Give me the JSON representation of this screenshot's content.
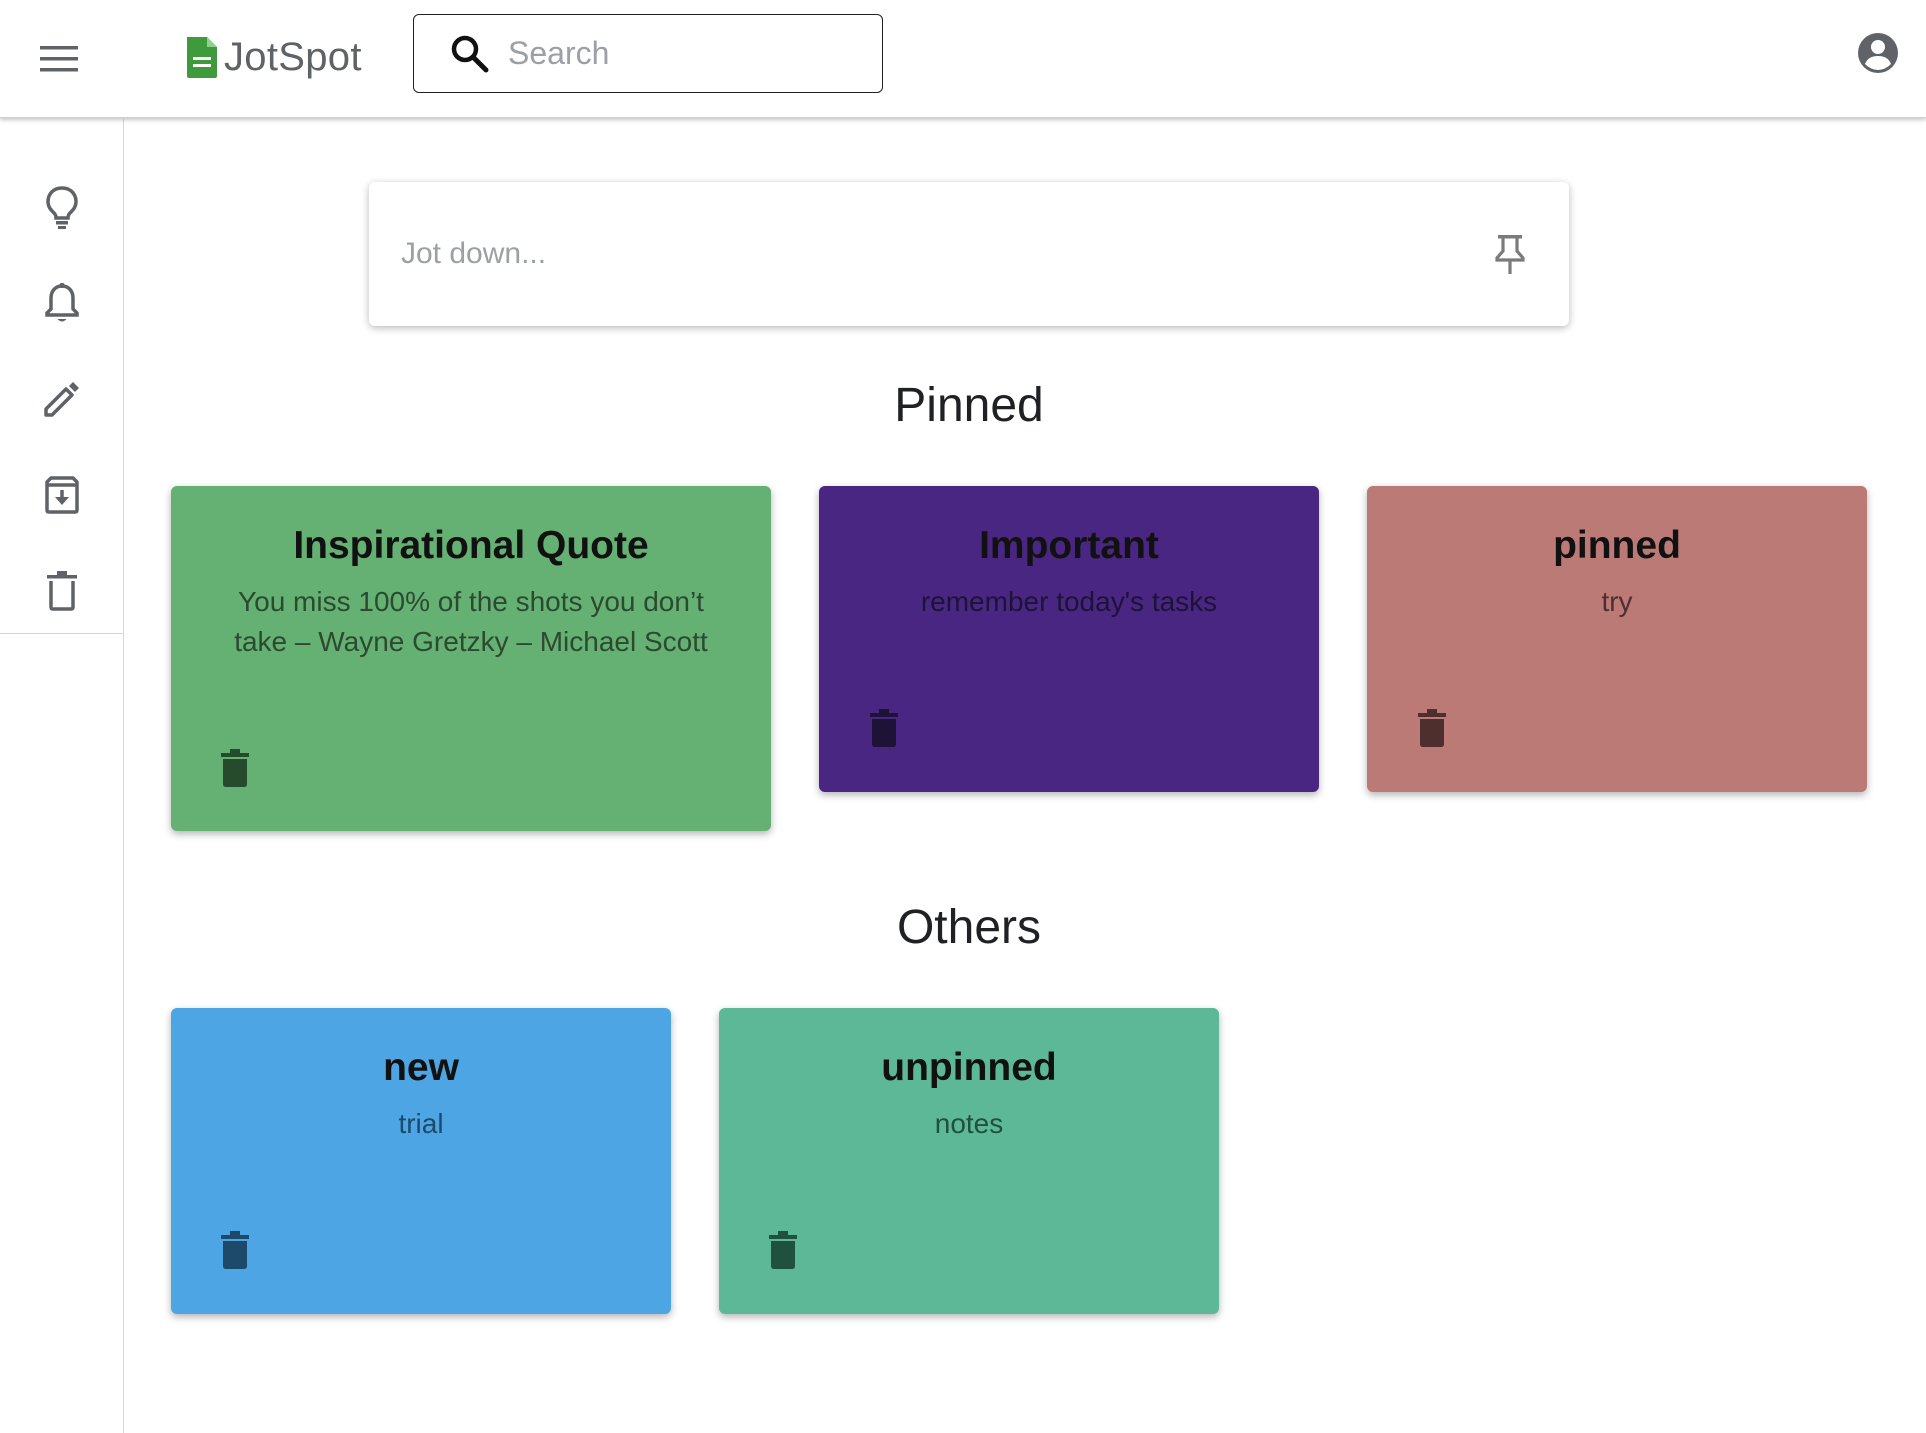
{
  "app": {
    "name": "JotSpot",
    "brand_color": "#4caf50"
  },
  "header": {
    "menu_icon": "hamburger-menu-icon",
    "search": {
      "placeholder": "Search",
      "value": ""
    },
    "account_icon": "account-circle-icon"
  },
  "sidebar": {
    "items": [
      {
        "name": "notes",
        "icon": "lightbulb-icon"
      },
      {
        "name": "reminders",
        "icon": "bell-icon"
      },
      {
        "name": "edit-labels",
        "icon": "pencil-icon"
      },
      {
        "name": "archive",
        "icon": "archive-icon"
      },
      {
        "name": "trash",
        "icon": "trash-icon"
      }
    ]
  },
  "composer": {
    "placeholder": "Jot down...",
    "pin_icon": "pin-icon"
  },
  "sections": {
    "pinned_title": "Pinned",
    "others_title": "Others"
  },
  "pinned_notes": [
    {
      "title": "Inspirational Quote",
      "body": "You miss 100% of the shots you don’t take – Wayne Gretzky – Michael Scott",
      "color": "#65b073",
      "trash_color": "#254a2c"
    },
    {
      "title": "Important",
      "body": "remember today's tasks",
      "color": "#4a2683",
      "trash_color": "#1e1236"
    },
    {
      "title": "pinned",
      "body": "try",
      "color": "#bc7a77",
      "trash_color": "#4e2f2e"
    }
  ],
  "other_notes": [
    {
      "title": "new",
      "body": "trial",
      "color": "#4da6e3",
      "trash_color": "#1d4a6a"
    },
    {
      "title": "unpinned",
      "body": "notes",
      "color": "#5cb897",
      "trash_color": "#20503e"
    }
  ]
}
